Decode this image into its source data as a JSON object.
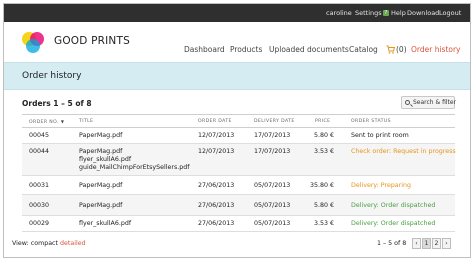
{
  "topbar": {
    "user": "caroline",
    "settings": "Settings",
    "help": "Help",
    "download": "Download",
    "logout": "Logout"
  },
  "brand": {
    "name": "GOOD PRINTS",
    "colors": [
      "#f5d000",
      "#e8006f",
      "#00a6e0"
    ]
  },
  "nav": {
    "dashboard": "Dashboard",
    "products": "Products",
    "uploaded": "Uploaded documents",
    "catalog": "Catalog",
    "cart_count": "(0)",
    "order_history": "Order history"
  },
  "page": {
    "title": "Order history"
  },
  "orders": {
    "count_label": "Orders 1 – 5 of 8",
    "search_label": "Search & filter",
    "columns": [
      "ORDER NO.",
      "TITLE",
      "ORDER DATE",
      "DELIVERY DATE",
      "PRICE",
      "ORDER STATUS"
    ],
    "rows": [
      {
        "no": "00045",
        "title": [
          "PaperMag.pdf"
        ],
        "order_date": "12/07/2013",
        "delivery_date": "17/07/2013",
        "price": "5.80 €",
        "status": "Sent to print room",
        "status_color": "#222222"
      },
      {
        "no": "00044",
        "title": [
          "PaperMag.pdf",
          "flyer_skullA6.pdf",
          "guide_MailChimpForEtsySellers.pdf"
        ],
        "order_date": "12/07/2013",
        "delivery_date": "17/07/2013",
        "price": "3.53 €",
        "status": "Check order: Request in progress",
        "status_color": "#e8941a"
      },
      {
        "no": "00031",
        "title": [
          "PaperMag.pdf"
        ],
        "order_date": "27/06/2013",
        "delivery_date": "05/07/2013",
        "price": "35.80 €",
        "status": "Delivery: Preparing",
        "status_color": "#e8941a"
      },
      {
        "no": "00030",
        "title": [
          "PaperMag.pdf"
        ],
        "order_date": "27/06/2013",
        "delivery_date": "05/07/2013",
        "price": "5.80 €",
        "status": "Delivery: Order dispatched",
        "status_color": "#4aa042"
      },
      {
        "no": "00029",
        "title": [
          "flyer_skullA6.pdf"
        ],
        "order_date": "27/06/2013",
        "delivery_date": "05/07/2013",
        "price": "3.53 €",
        "status": "Delivery: Order dispatched",
        "status_color": "#4aa042"
      }
    ]
  },
  "footer": {
    "view_label": "View:",
    "compact": "compact",
    "detailed": "detailed",
    "range": "1 – 5 of 8",
    "prev": "‹",
    "page1": "1",
    "page2": "2",
    "next": "›"
  }
}
